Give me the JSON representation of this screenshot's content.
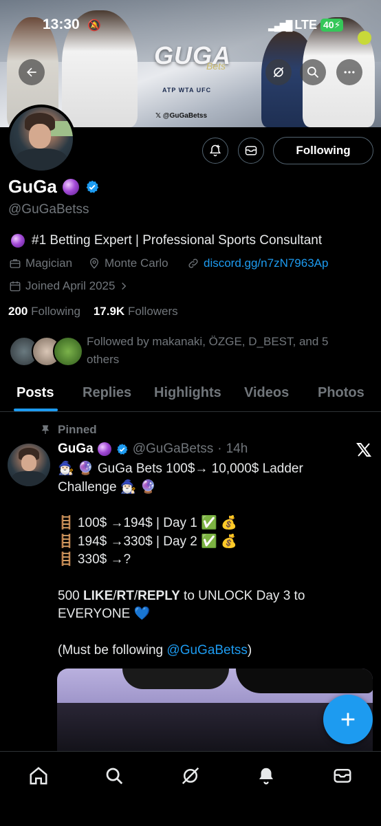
{
  "status_bar": {
    "time": "13:30",
    "network": "LTE",
    "battery": "40"
  },
  "banner": {
    "logo_text": "GUGA",
    "logo_sub": "Bets",
    "sponsors": "ATP WTA UFC",
    "handle": "@GuGaBetss"
  },
  "profile": {
    "name": "GuGa",
    "handle": "@GuGaBetss",
    "bio": "#1 Betting Expert | Professional Sports Consultant",
    "occupation": "Magician",
    "location": "Monte Carlo",
    "link": "discord.gg/n7zN7963Ap",
    "joined": "Joined April 2025",
    "following_count": "200",
    "following_label": "Following",
    "followers_count": "17.9K",
    "followers_label": "Followers",
    "followed_by": "Followed by makanaki, ÖZGE, D_BEST, and 5 others",
    "follow_button": "Following"
  },
  "tabs": [
    "Posts",
    "Replies",
    "Highlights",
    "Videos",
    "Photos"
  ],
  "post": {
    "pinned_label": "Pinned",
    "author": "GuGa",
    "handle": "@GuGaBetss",
    "time": "14h",
    "line1": "🧙🏻‍♂️ 🔮 GuGa Bets 100$→ 10,000$ Ladder Challenge 🧙🏻‍♂️ 🔮",
    "line2": "🪜 100$ →194$ | Day 1 ✅ 💰",
    "line3": "🪜 194$ →330$ | Day 2 ✅ 💰",
    "line4": "🪜 330$ →?",
    "line5_a": "500 ",
    "line5_like": "LIKE",
    "line5_s1": "/",
    "line5_rt": "RT",
    "line5_s2": "/",
    "line5_reply": "REPLY",
    "line5_b": " to UNLOCK Day 3 to EVERYONE 💙",
    "line6_a": "(Must be following ",
    "line6_mention": "@GuGaBetss",
    "line6_b": ")"
  },
  "colors": {
    "accent": "#1d9bf0",
    "muted": "#71767b",
    "background": "#000000",
    "battery_green": "#35c759"
  }
}
